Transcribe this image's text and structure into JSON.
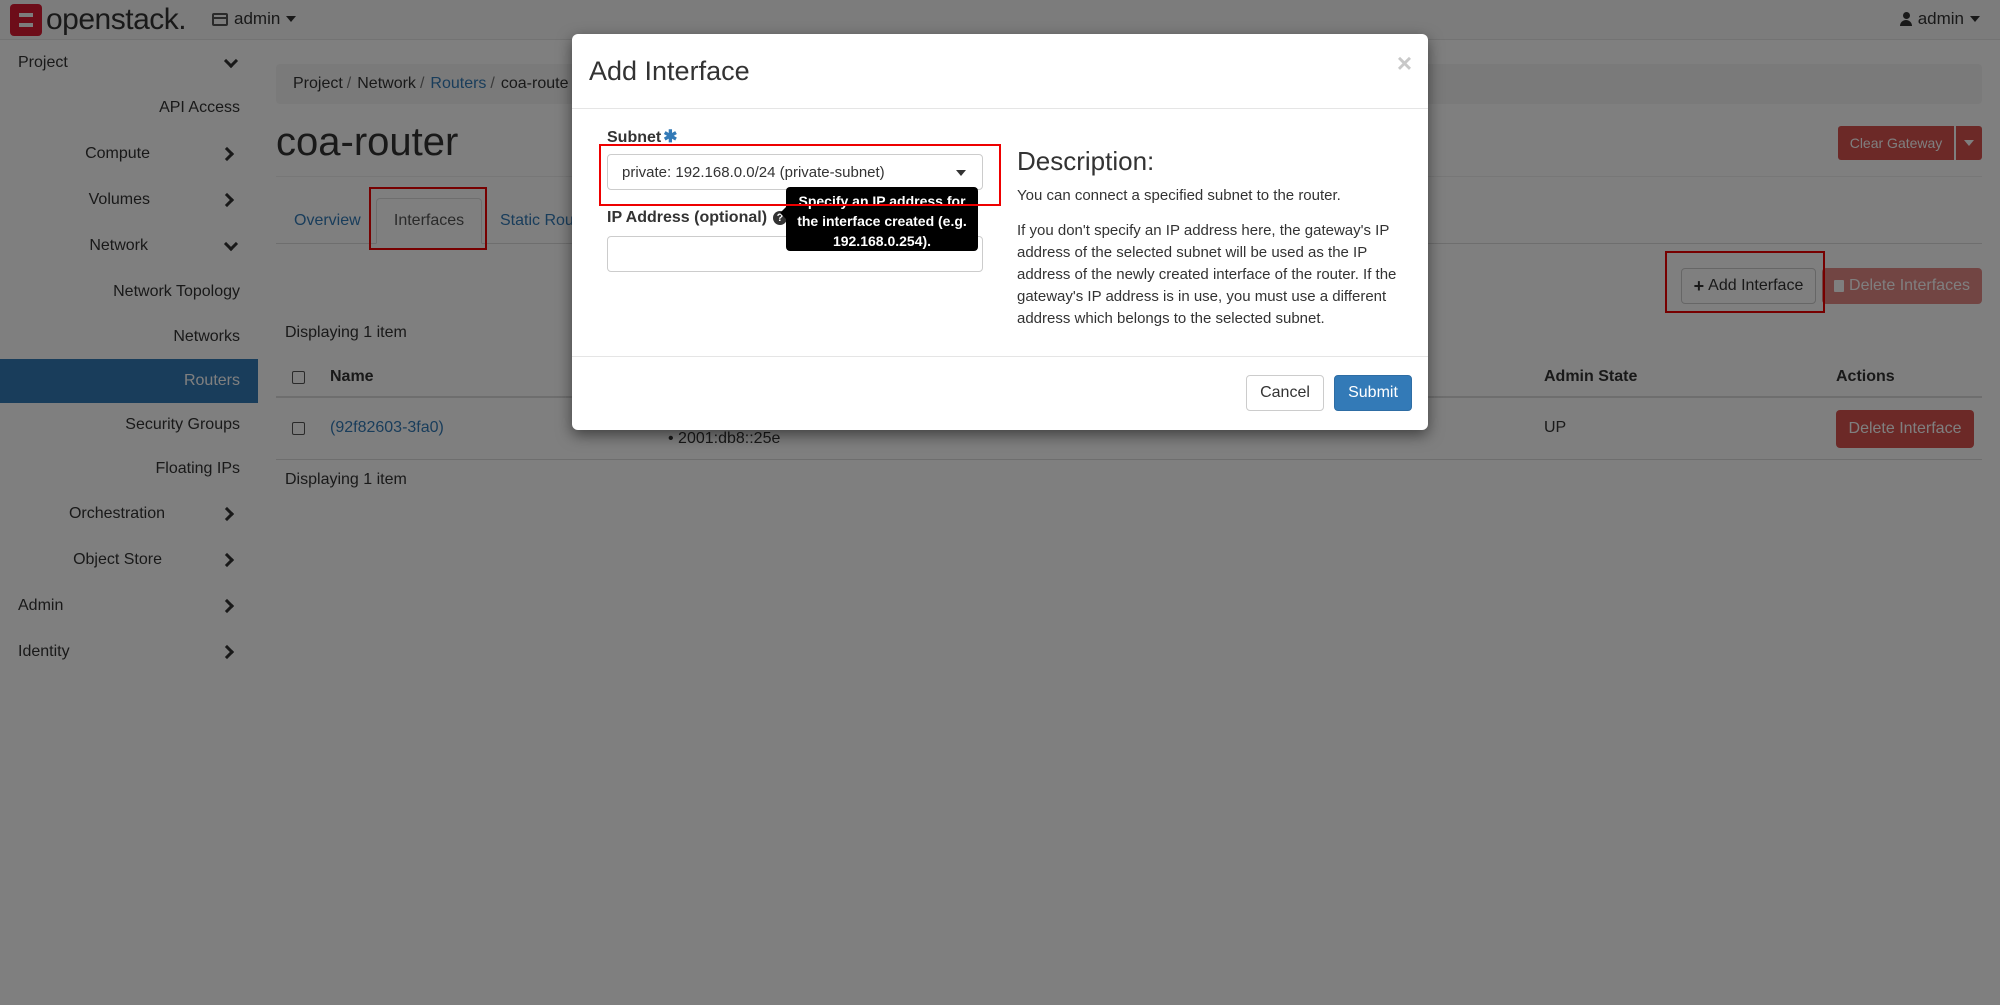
{
  "header": {
    "brand": "openstack.",
    "project": "admin",
    "user": "admin"
  },
  "sidebar": {
    "project": "Project",
    "api_access": "API Access",
    "compute": "Compute",
    "volumes": "Volumes",
    "network": "Network",
    "network_topology": "Network Topology",
    "networks": "Networks",
    "routers": "Routers",
    "security_groups": "Security Groups",
    "floating_ips": "Floating IPs",
    "orchestration": "Orchestration",
    "object_store": "Object Store",
    "admin": "Admin",
    "identity": "Identity"
  },
  "breadcrumb": [
    "Project",
    "Network",
    "Routers",
    "coa-route"
  ],
  "page": {
    "title": "coa-router",
    "clear_gateway": "Clear Gateway",
    "tabs": [
      "Overview",
      "Interfaces",
      "Static Rou"
    ],
    "add_interface": "Add Interface",
    "delete_interfaces": "Delete Interfaces",
    "display_count": "Displaying 1 item",
    "columns": {
      "name": "Name",
      "admin_state": "Admin State",
      "actions": "Actions"
    },
    "rows": [
      {
        "name": "(92f82603-3fa0)",
        "fixed_ip": "2001:db8::25e",
        "admin_state": "UP",
        "action": "Delete Interface"
      }
    ]
  },
  "modal": {
    "title": "Add Interface",
    "close": "×",
    "subnet_label": "Subnet",
    "subnet_value": "private: 192.168.0.0/24 (private-subnet)",
    "ip_label": "IP Address (optional)",
    "ip_value": "",
    "tooltip": "Specify an IP address for the interface created (e.g. 192.168.0.254).",
    "desc_title": "Description:",
    "desc_1": "You can connect a specified subnet to the router.",
    "desc_2": "If you don't specify an IP address here, the gateway's IP address of the selected subnet will be used as the IP address of the newly created interface of the router. If the gateway's IP address is in use, you must use a different address which belongs to the selected subnet.",
    "cancel": "Cancel",
    "submit": "Submit"
  },
  "colors": {
    "brand": "#da1a32",
    "primary": "#337ab7",
    "danger": "#d9534f",
    "highlight": "#ee0000"
  }
}
